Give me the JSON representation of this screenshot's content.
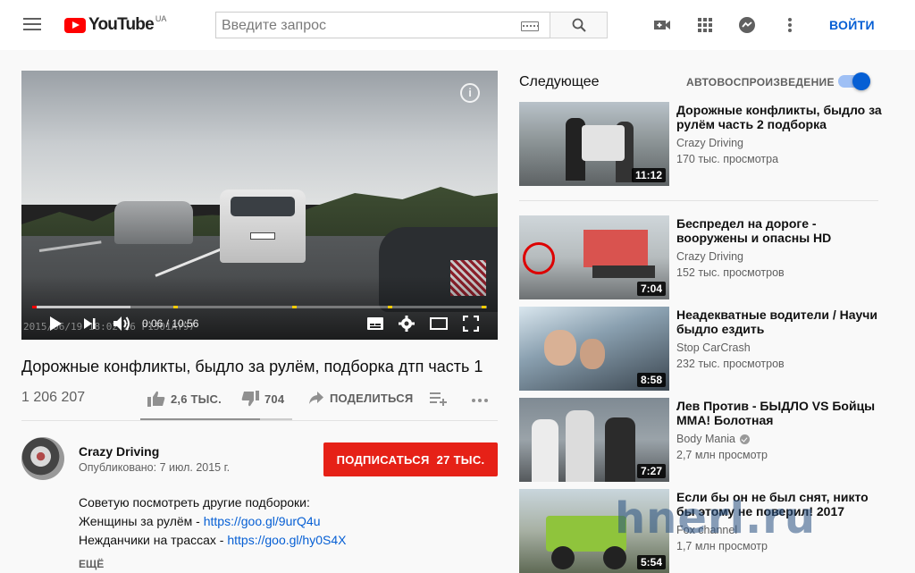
{
  "header": {
    "logo_text": "YouTube",
    "logo_region": "UA",
    "search_placeholder": "Введите запрос",
    "login_label": "ВОЙТИ",
    "icons": [
      "menu-icon",
      "keyboard-icon",
      "search-icon",
      "upload-video-icon",
      "apps-grid-icon",
      "messages-icon",
      "more-vert-icon"
    ]
  },
  "player": {
    "time": "0:06 / 10:56",
    "progress_fraction": 0.009,
    "dashcam_stamp": "2015/06/19 18:02:26 P1301AY97",
    "icons": [
      "play-icon",
      "next-icon",
      "volume-icon",
      "subtitles-icon",
      "settings-icon",
      "theater-icon",
      "fullscreen-icon",
      "info-icon"
    ]
  },
  "video": {
    "title": "Дорожные конфликты, быдло за рулём, подборка дтп часть 1",
    "views": "1 206 207",
    "likes": "2,6 ТЫС.",
    "dislikes": "704",
    "share_label": "ПОДЕЛИТЬСЯ",
    "like_fraction": 0.79
  },
  "channel": {
    "name": "Crazy Driving",
    "published": "Опубликовано: 7 июл. 2015 г.",
    "subscribe_label": "ПОДПИСАТЬСЯ",
    "subscriber_count": "27 ТЫС."
  },
  "description": {
    "line1": "Советую посмотреть другие подбороки:",
    "line2_text": "Женщины за рулём - ",
    "line2_link": "https://goo.gl/9urQ4u",
    "line3_text": "Нежданчики на трассах - ",
    "line3_link": "https://goo.gl/hy0S4X",
    "more_label": "ЕЩЁ"
  },
  "sidebar": {
    "up_next_label": "Следующее",
    "autoplay_label": "АВТОВОСПРОИЗВЕДЕНИЕ",
    "autoplay_on": true,
    "items": [
      {
        "title": "Дорожные конфликты, быдло за рулём часть 2 подборка",
        "channel": "Crazy Driving",
        "views": "170 тыс. просмотра",
        "duration": "11:12",
        "verified": false
      },
      {
        "title": "Беспредел на дороге - вооружены и опасны HD",
        "channel": "Crazy Driving",
        "views": "152 тыс. просмотров",
        "duration": "7:04",
        "verified": false
      },
      {
        "title": "Неадекватные водители / Научи быдло ездить",
        "channel": "Stop CarCrash",
        "views": "232 тыс. просмотров",
        "duration": "8:58",
        "verified": false
      },
      {
        "title": "Лев Против - БЫДЛО VS Бойцы ММА! Болотная",
        "channel": "Body Mania",
        "views": "2,7 млн просмотр",
        "duration": "7:27",
        "verified": true
      },
      {
        "title": "Если бы он не был снят, никто бы этому не поверил! 2017",
        "channel": "Fox channel",
        "views": "1,7 млн просмотр",
        "duration": "5:54",
        "verified": false
      }
    ]
  },
  "watermark_text": "hnerl.ru"
}
